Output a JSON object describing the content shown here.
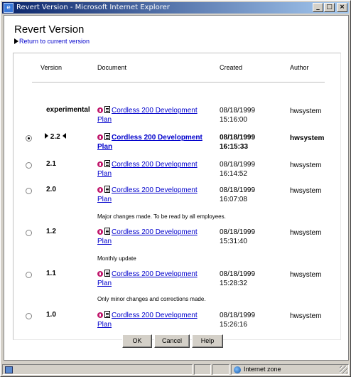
{
  "window": {
    "title": "Revert Version - Microsoft Internet Explorer",
    "minimize": "_",
    "maximize": "□",
    "close": "×"
  },
  "page": {
    "title": "Revert Version",
    "return_link": "Return to current version"
  },
  "table": {
    "headers": {
      "version": "Version",
      "document": "Document",
      "created": "Created",
      "author": "Author"
    },
    "rows": [
      {
        "version": "experimental",
        "doc_line1": "Cordless 200 Development",
        "doc_line2": "Plan",
        "created_date": "08/18/1999",
        "created_time": "15:16:00",
        "author": "hwsystem",
        "note": ""
      },
      {
        "version": "2.2",
        "doc_line1": "Cordless 200 Development",
        "doc_line2": "Plan",
        "created_date": "08/18/1999",
        "created_time": "16:15:33",
        "author": "hwsystem",
        "note": ""
      },
      {
        "version": "2.1",
        "doc_line1": "Cordless 200 Development",
        "doc_line2": "Plan",
        "created_date": "08/18/1999",
        "created_time": "16:14:52",
        "author": "hwsystem",
        "note": ""
      },
      {
        "version": "2.0",
        "doc_line1": "Cordless 200 Development",
        "doc_line2": "Plan",
        "created_date": "08/18/1999",
        "created_time": "16:07:08",
        "author": "hwsystem",
        "note": "Major changes made. To be read by all employees."
      },
      {
        "version": "1.2",
        "doc_line1": "Cordless 200 Development",
        "doc_line2": "Plan",
        "created_date": "08/18/1999",
        "created_time": "15:31:40",
        "author": "hwsystem",
        "note": "Monthly update"
      },
      {
        "version": "1.1",
        "doc_line1": "Cordless 200 Development",
        "doc_line2": "Plan",
        "created_date": "08/18/1999",
        "created_time": "15:28:32",
        "author": "hwsystem",
        "note": "Only minor changes and corrections made."
      },
      {
        "version": "1.0",
        "doc_line1": "Cordless 200 Development",
        "doc_line2": "Plan",
        "created_date": "08/18/1999",
        "created_time": "15:26:16",
        "author": "hwsystem",
        "note": ""
      }
    ]
  },
  "buttons": {
    "ok": "OK",
    "cancel": "Cancel",
    "help": "Help"
  },
  "statusbar": {
    "zone": "Internet zone"
  },
  "colors": {
    "link": "#0000cc",
    "title_bar": "#0a246a",
    "check_in_icon": "#c0186c"
  }
}
